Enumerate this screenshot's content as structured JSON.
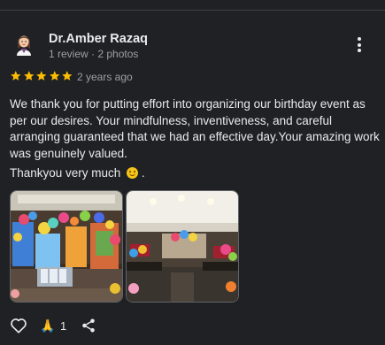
{
  "review": {
    "author": "Dr.Amber Razaq",
    "author_meta": "1 review · 2 photos",
    "rating": 5,
    "time": "2 years ago",
    "text": "We thank you for putting effort into organizing our birthday event as per our desires. Your mindfulness, inventiveness, and careful arranging guaranteed that we had an effective day.Your amazing work was genuinely valued.",
    "closing": "Thankyou very much",
    "closing_suffix": ".",
    "photos": [
      "photo-1",
      "photo-2"
    ]
  },
  "actions": {
    "reaction_emoji": "🙏",
    "reaction_count": "1",
    "like_icon": "heart-outline-icon",
    "share_icon": "share-icon"
  },
  "colors": {
    "background": "#202124",
    "star": "#fbbc04",
    "primary_text": "#e8eaed",
    "secondary_text": "#9aa0a6"
  }
}
